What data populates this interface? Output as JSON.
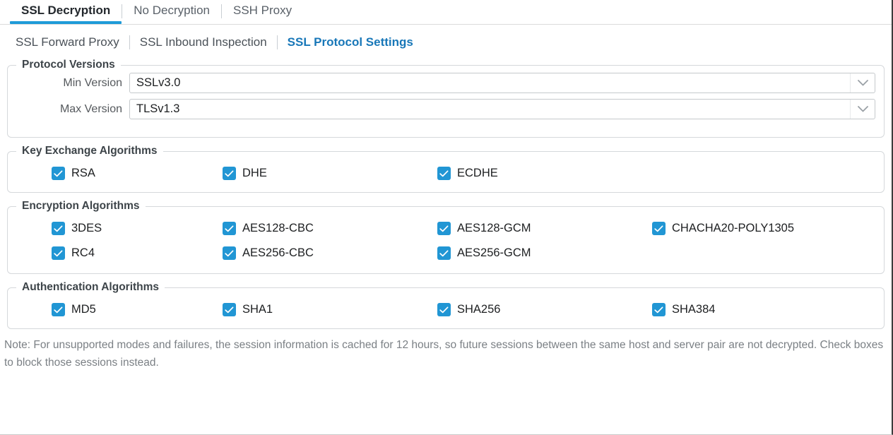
{
  "tabs": {
    "items": [
      {
        "label": "SSL Decryption",
        "active": true
      },
      {
        "label": "No Decryption",
        "active": false
      },
      {
        "label": "SSH Proxy",
        "active": false
      }
    ],
    "active_underline_color": "#1f9bd8"
  },
  "subtabs": {
    "items": [
      {
        "label": "SSL Forward Proxy",
        "active": false
      },
      {
        "label": "SSL Inbound Inspection",
        "active": false
      },
      {
        "label": "SSL Protocol Settings",
        "active": true
      }
    ],
    "active_color": "#1877b8"
  },
  "protocol_versions": {
    "legend": "Protocol Versions",
    "fields": [
      {
        "label": "Min Version",
        "value": "SSLv3.0",
        "icon": "chevron-down-icon"
      },
      {
        "label": "Max Version",
        "value": "TLSv1.3",
        "icon": "chevron-down-icon"
      }
    ]
  },
  "key_exchange": {
    "legend": "Key Exchange Algorithms",
    "columns": [
      [
        {
          "label": "RSA",
          "checked": true
        }
      ],
      [
        {
          "label": "DHE",
          "checked": true
        }
      ],
      [
        {
          "label": "ECDHE",
          "checked": true
        }
      ],
      []
    ]
  },
  "encryption": {
    "legend": "Encryption Algorithms",
    "columns": [
      [
        {
          "label": "3DES",
          "checked": true
        },
        {
          "label": "RC4",
          "checked": true
        }
      ],
      [
        {
          "label": "AES128-CBC",
          "checked": true
        },
        {
          "label": "AES256-CBC",
          "checked": true
        }
      ],
      [
        {
          "label": "AES128-GCM",
          "checked": true
        },
        {
          "label": "AES256-GCM",
          "checked": true
        }
      ],
      [
        {
          "label": "CHACHA20-POLY1305",
          "checked": true
        }
      ]
    ]
  },
  "authentication": {
    "legend": "Authentication Algorithms",
    "columns": [
      [
        {
          "label": "MD5",
          "checked": true
        }
      ],
      [
        {
          "label": "SHA1",
          "checked": true
        }
      ],
      [
        {
          "label": "SHA256",
          "checked": true
        }
      ],
      [
        {
          "label": "SHA384",
          "checked": true
        }
      ]
    ]
  },
  "note": {
    "text": "Note: For unsupported modes and failures, the session information is cached for 12 hours, so future sessions between the same host and server pair are not decrypted. Check boxes to block those sessions instead."
  },
  "colors": {
    "checkbox_blue": "#2196d4",
    "accent_blue": "#1877b8",
    "tab_underline": "#1f9bd8",
    "border_grey": "#d5d8db",
    "note_grey": "#7b8085"
  }
}
